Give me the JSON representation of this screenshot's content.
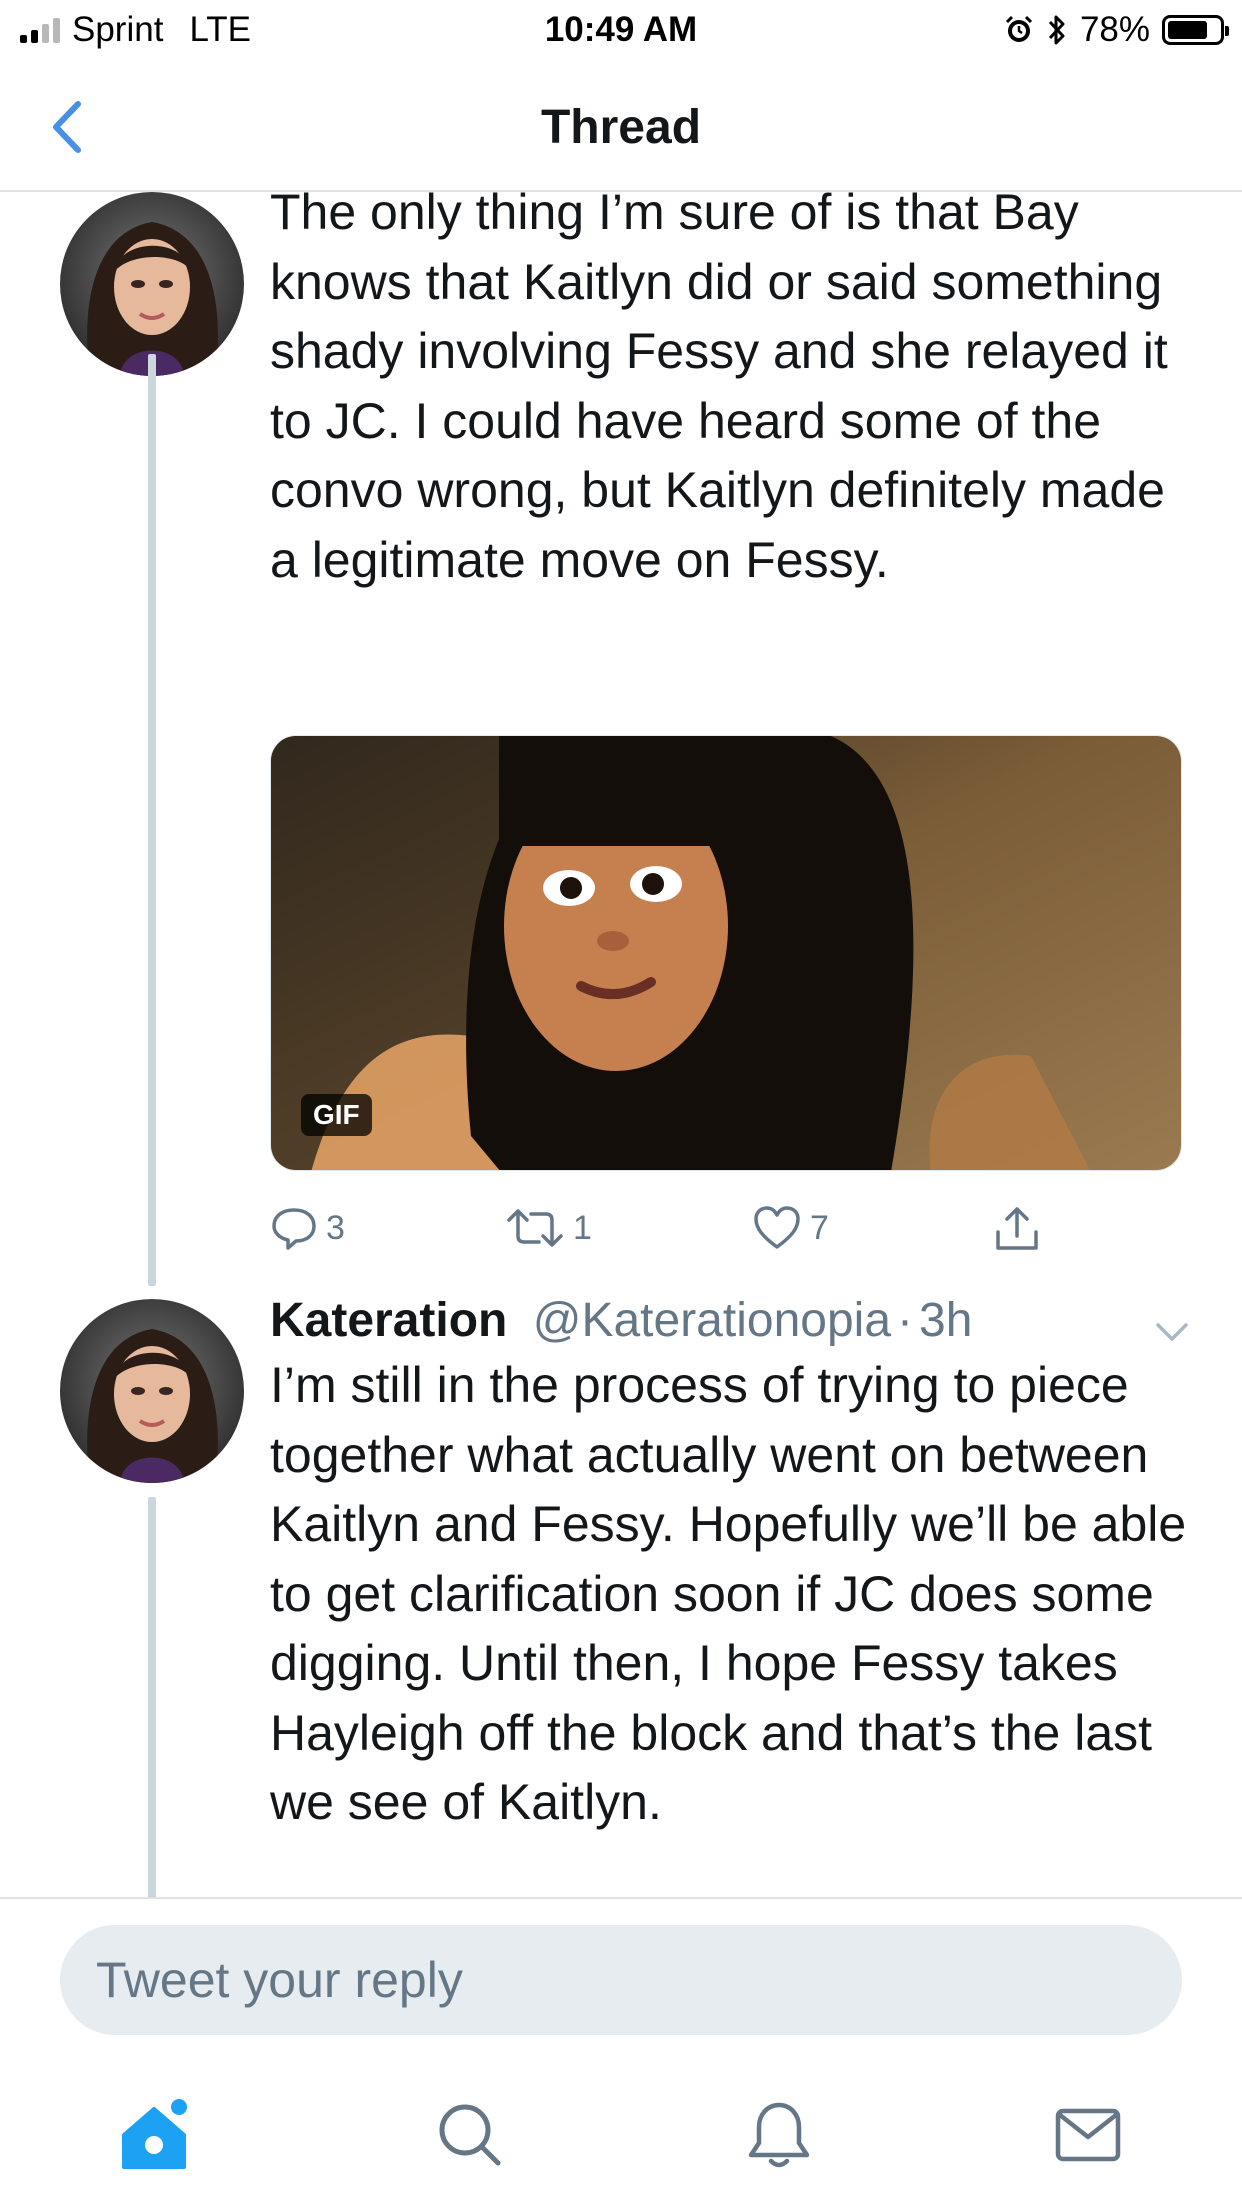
{
  "status_bar": {
    "carrier": "Sprint",
    "network": "LTE",
    "time": "10:49 AM",
    "battery": "78%",
    "battery_level": 0.78
  },
  "nav": {
    "title": "Thread"
  },
  "tweets": [
    {
      "text": "The only thing I’m sure of is that Bay knows that Kaitlyn did or said something shady involving Fessy and she relayed it to JC. I could have heard some of the convo wrong, but Kaitlyn definitely made a legitimate move on Fessy.",
      "media_badge": "GIF",
      "replies": "3",
      "retweets": "1",
      "likes": "7"
    },
    {
      "name": "Kateration",
      "handle": "@Katerationopia",
      "sep": "·",
      "time": "3h",
      "text": "I’m still in the process of trying to piece together what actually went on between Kaitlyn and Fessy. Hopefully we’ll be able to get clarification soon if JC does some digging. Until then, I hope Fessy takes Hayleigh off the block and that’s the last we see of Kaitlyn."
    }
  ],
  "reply": {
    "placeholder": "Tweet your reply"
  },
  "colors": {
    "accent": "#1da1f2",
    "link": "#4a90e2",
    "secondary_text": "#657786",
    "thread_line": "#ccd6dd",
    "reply_bg": "#e6ecf0"
  },
  "icons": {
    "back": "chevron-left-icon",
    "reply": "reply-icon",
    "retweet": "retweet-icon",
    "like": "heart-icon",
    "share": "share-icon",
    "home": "home-icon",
    "search": "search-icon",
    "notifications": "bell-icon",
    "messages": "mail-icon"
  }
}
